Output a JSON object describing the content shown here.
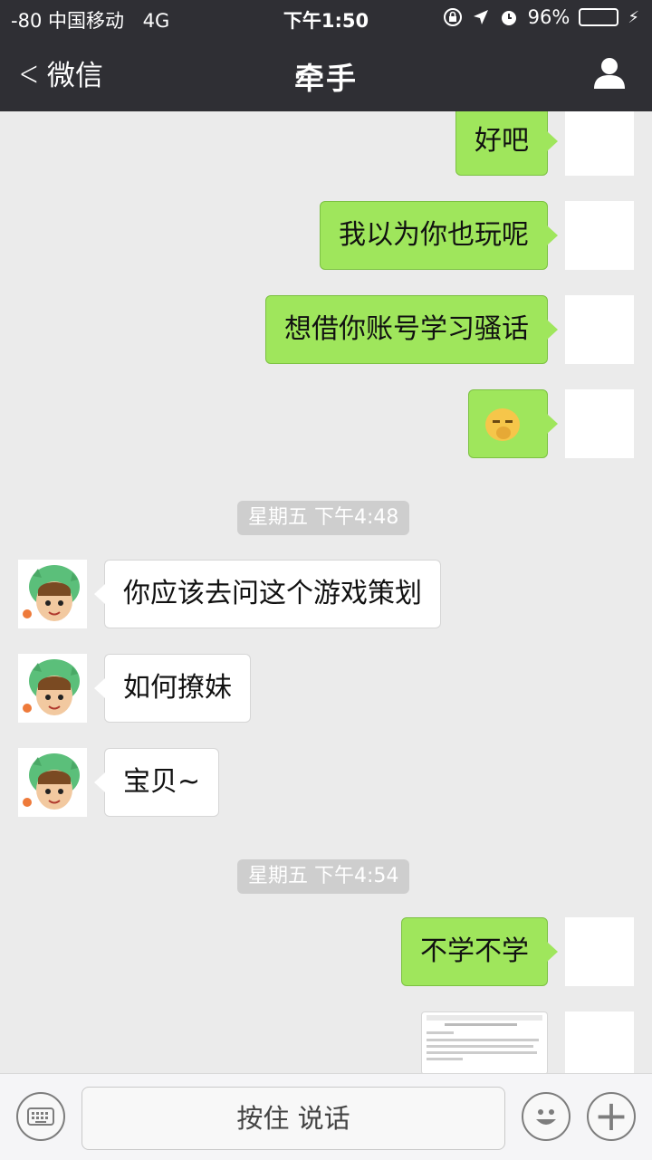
{
  "status_bar": {
    "carrier": "-80 中国移动",
    "network": "4G",
    "time": "下午1:50",
    "battery": "96%",
    "battery_level": 0.96
  },
  "nav": {
    "back_label": "微信",
    "title": "牵手"
  },
  "messages": [
    {
      "side": "me",
      "text": "好吧"
    },
    {
      "side": "me",
      "text": "我以为你也玩呢"
    },
    {
      "side": "me",
      "text": "想借你账号学习骚话"
    },
    {
      "side": "me",
      "type": "emoji",
      "icon": "smirk-emoji-icon"
    },
    {
      "type": "timestamp",
      "text": "星期五 下午4:48"
    },
    {
      "side": "peer",
      "text": "你应该去问这个游戏策划"
    },
    {
      "side": "peer",
      "text": "如何撩妹"
    },
    {
      "side": "peer",
      "text": "宝贝~"
    },
    {
      "type": "timestamp",
      "text": "星期五 下午4:54"
    },
    {
      "side": "me",
      "text": "不学不学"
    },
    {
      "side": "me",
      "type": "image",
      "icon": "screenshot-thumbnail"
    }
  ],
  "input_bar": {
    "hold_to_talk": "按住 说话"
  },
  "colors": {
    "nav_bg": "#2f2f34",
    "chat_bg": "#ebebeb",
    "my_bubble": "#9fe65c",
    "peer_bubble": "#ffffff",
    "battery_fill": "#4cd964"
  }
}
